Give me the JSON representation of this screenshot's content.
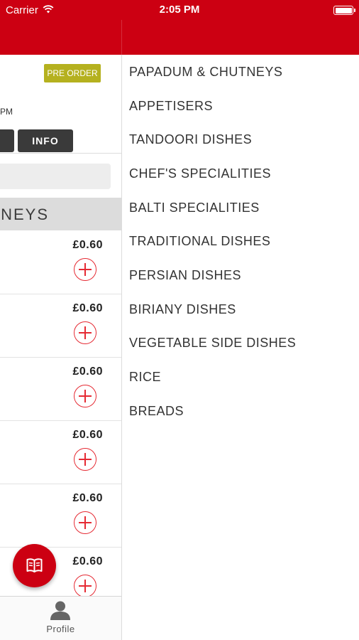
{
  "status_bar": {
    "carrier": "Carrier",
    "time": "2:05 PM"
  },
  "colors": {
    "brand_red": "#cc0012",
    "preorder_bg": "#b5b11f",
    "add_red": "#e52a33"
  },
  "restaurant_panel": {
    "preorder_badge": "PRE ORDER",
    "time_fragment": "PM",
    "info_button": "INFO",
    "current_category_fragment": "NEYS",
    "items": [
      {
        "price": "£0.60"
      },
      {
        "price": "£0.60"
      },
      {
        "price": "£0.60"
      },
      {
        "price": "£0.60"
      },
      {
        "price": "£0.60"
      },
      {
        "price": "£0.60"
      }
    ],
    "fab_icon": "menu-book-icon"
  },
  "tab_bar": {
    "profile_label": "Profile",
    "profile_icon": "profile-icon"
  },
  "drawer": {
    "categories": [
      {
        "label": "PAPADUM & CHUTNEYS"
      },
      {
        "label": "APPETISERS"
      },
      {
        "label": "TANDOORI DISHES"
      },
      {
        "label": "CHEF'S SPECIALITIES"
      },
      {
        "label": "BALTI SPECIALITIES"
      },
      {
        "label": "TRADITIONAL DISHES"
      },
      {
        "label": "PERSIAN DISHES"
      },
      {
        "label": "BIRIANY DISHES"
      },
      {
        "label": "VEGETABLE SIDE DISHES"
      },
      {
        "label": "RICE"
      },
      {
        "label": "BREADS"
      }
    ]
  }
}
